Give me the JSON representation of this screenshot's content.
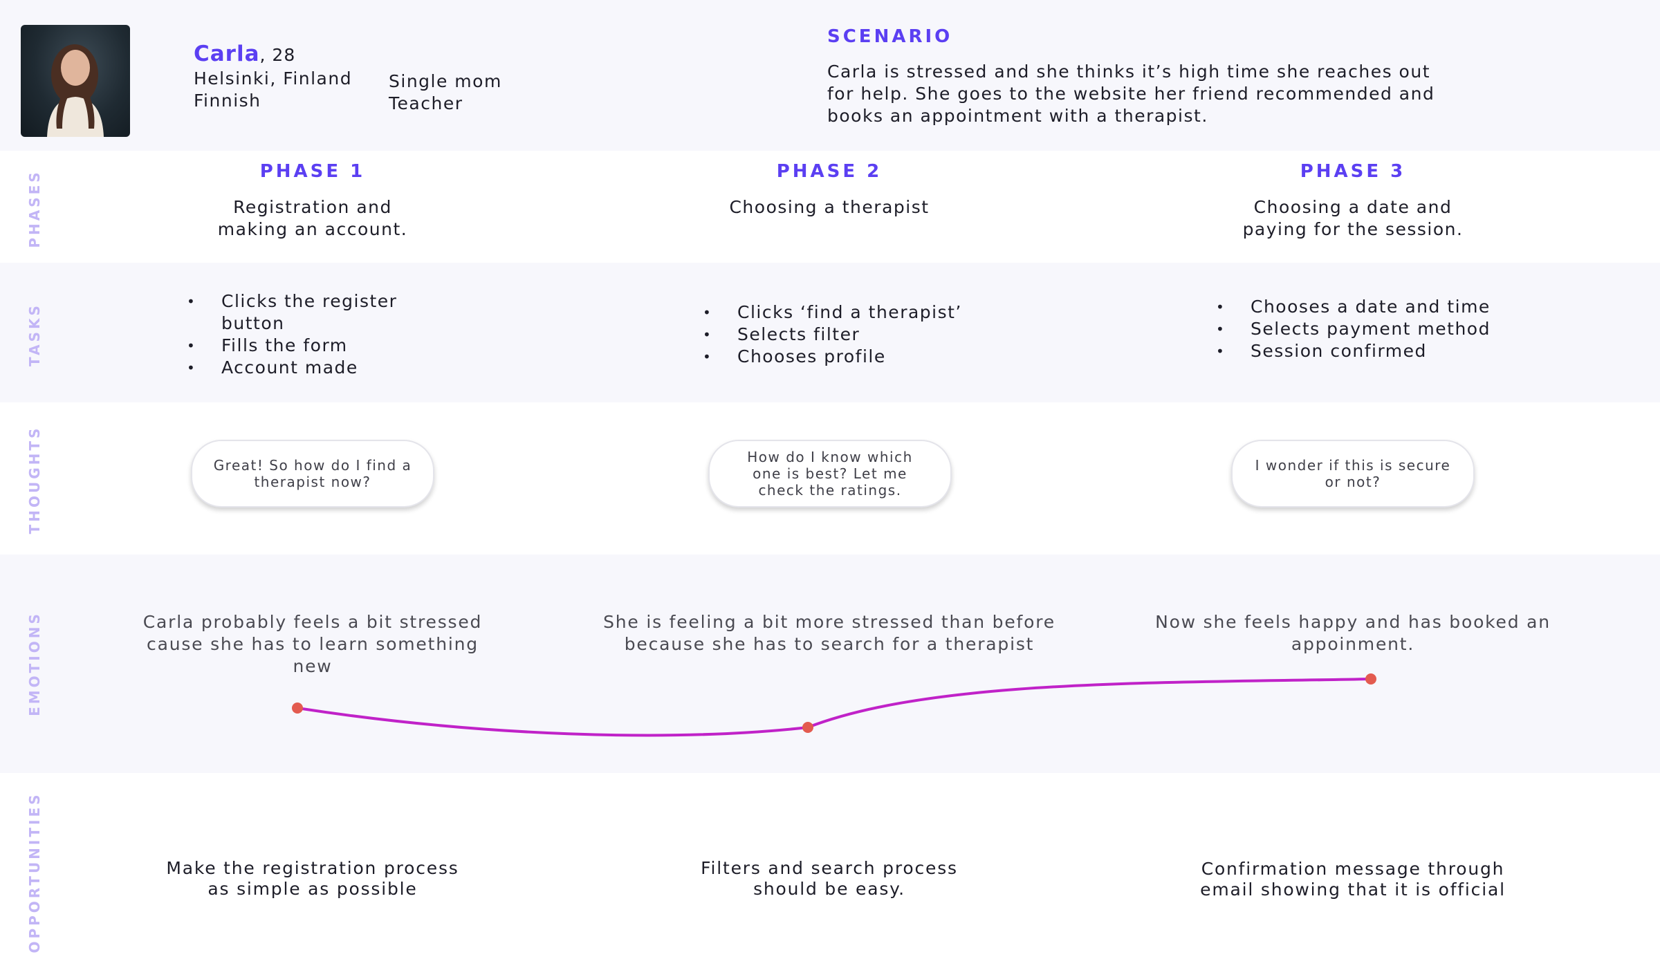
{
  "persona": {
    "name": "Carla",
    "age_suffix": ", 28",
    "location": "Helsinki, Finland",
    "nationality": "Finnish",
    "status": "Single mom",
    "job": "Teacher"
  },
  "scenario": {
    "title": "SCENARIO",
    "text": "Carla is stressed and she thinks it’s high time she reaches out for help. She goes to the website her friend recommended and books an appointment with a therapist."
  },
  "row_labels": {
    "phases": "PHASES",
    "tasks": "TASKS",
    "thoughts": "THOUGHTS",
    "emotions": "EMOTIONS",
    "opportunities": "OPPORTUNITIES"
  },
  "phases": [
    {
      "title": "PHASE 1",
      "description": [
        "Registration and",
        "making an account."
      ],
      "tasks": [
        "Clicks the register button",
        "Fills the form",
        "Account made"
      ],
      "thought": "Great! So how do I find a therapist now?",
      "emotion": "Carla probably feels a bit stressed cause she has to learn something new",
      "opportunity": "Make the registration process as simple as possible"
    },
    {
      "title": "PHASE 2",
      "description": [
        "Choosing a therapist"
      ],
      "tasks": [
        "Clicks ‘find a therapist’",
        "Selects filter",
        "Chooses profile"
      ],
      "thought": "How do I know which one is best? Let me check the ratings.",
      "emotion": "She is feeling a bit more stressed than before because she has to search for a therapist",
      "opportunity": "Filters and search process should be easy."
    },
    {
      "title": "PHASE 3",
      "description": [
        "Choosing a date and",
        "paying for the session."
      ],
      "tasks": [
        "Chooses a date and time",
        "Selects payment method",
        "Session confirmed"
      ],
      "thought": "I wonder if this is secure or not?",
      "emotion": "Now she feels happy and has booked an appoinment.",
      "opportunity": "Confirmation message through email showing that it is official"
    }
  ],
  "emotion_curve": {
    "levels": [
      0.45,
      0.35,
      0.6
    ],
    "line_color": "#c022c8",
    "point_color": "#e35b4f"
  },
  "colors": {
    "accent": "#5b3ff2",
    "row_label": "#c2b5f6",
    "tint": "#f7f7fc"
  }
}
